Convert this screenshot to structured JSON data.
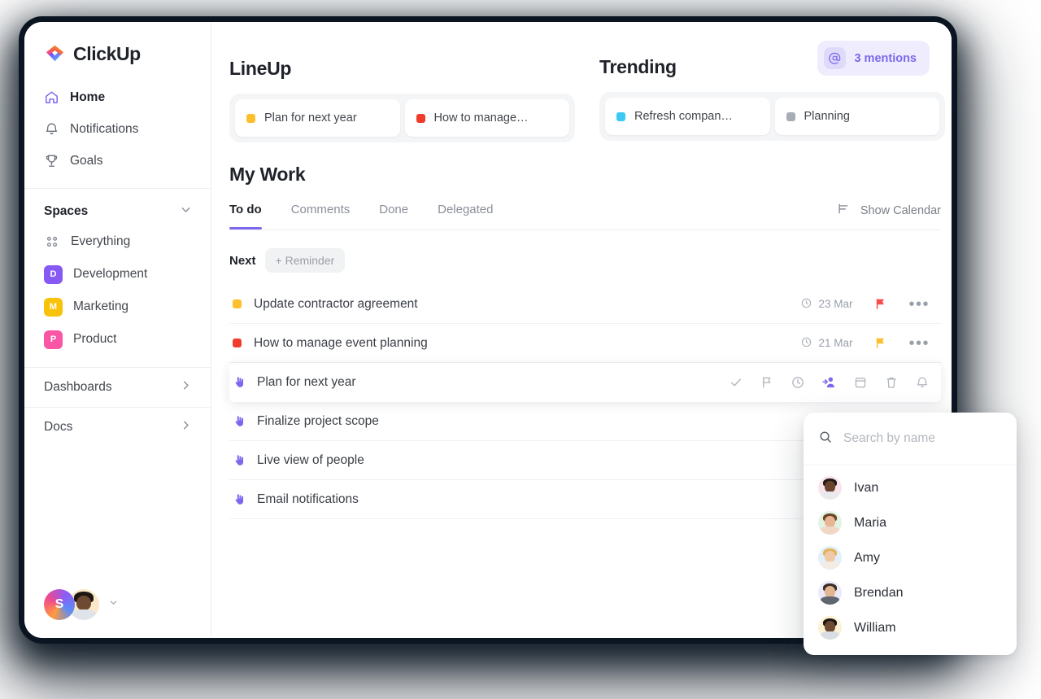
{
  "brand": {
    "name": "ClickUp",
    "logo_icon": "clickup-logo-icon",
    "accent": "#7b68ee"
  },
  "sidebar": {
    "nav": [
      {
        "label": "Home",
        "icon": "home-icon",
        "active": true
      },
      {
        "label": "Notifications",
        "icon": "bell-icon",
        "active": false
      },
      {
        "label": "Goals",
        "icon": "trophy-icon",
        "active": false
      }
    ],
    "spaces": {
      "title": "Spaces",
      "chevron_icon": "chevron-down-icon",
      "items": [
        {
          "label": "Everything",
          "badge": "",
          "icon": "grid-icon",
          "color": ""
        },
        {
          "label": "Development",
          "badge": "D",
          "color": "#8659f2"
        },
        {
          "label": "Marketing",
          "badge": "M",
          "color": "#f9c20a"
        },
        {
          "label": "Product",
          "badge": "P",
          "color": "#f956a5"
        }
      ]
    },
    "rows": [
      {
        "label": "Dashboards",
        "icon": "chevron-right-icon"
      },
      {
        "label": "Docs",
        "icon": "chevron-right-icon"
      }
    ],
    "footer": {
      "workspace_initial": "S",
      "user_avatar": "user-avatar",
      "caret_icon": "caret-down-icon"
    }
  },
  "header": {
    "mentions": {
      "label": "3 mentions",
      "icon": "at-icon"
    }
  },
  "lineup": {
    "title": "LineUp",
    "chips": [
      {
        "label": "Plan for next year",
        "color": "#fcbf2d"
      },
      {
        "label": "How to manage…",
        "color": "#ef3c2d"
      }
    ]
  },
  "trending": {
    "title": "Trending",
    "chips": [
      {
        "label": "Refresh compan…",
        "color": "#3ccaf5"
      },
      {
        "label": "Planning",
        "color": "#a8adb5"
      }
    ]
  },
  "my_work": {
    "title": "My Work",
    "tabs": [
      {
        "label": "To do",
        "active": true
      },
      {
        "label": "Comments",
        "active": false
      },
      {
        "label": "Done",
        "active": false
      },
      {
        "label": "Delegated",
        "active": false
      }
    ],
    "show_calendar": {
      "label": "Show Calendar",
      "icon": "calendar-toggle-icon"
    },
    "group": {
      "label": "Next",
      "add_reminder_label": "+ Reminder"
    },
    "tasks": [
      {
        "name": "Update contractor agreement",
        "marker": "dot",
        "dot_color": "#fcbf2d",
        "due": "23 Mar",
        "due_icon": "clock-icon",
        "flag_color": "#fb4b4b",
        "more_icon": "ellipsis-icon",
        "hovered": false
      },
      {
        "name": "How to manage event planning",
        "marker": "dot",
        "dot_color": "#ef3c2d",
        "due": "21 Mar",
        "due_icon": "clock-icon",
        "flag_color": "#fcbf2d",
        "more_icon": "ellipsis-icon",
        "hovered": false
      },
      {
        "name": "Plan for next year",
        "marker": "hand",
        "hovered": true,
        "actions": [
          {
            "icon": "check-icon",
            "active": false
          },
          {
            "icon": "flag-icon",
            "active": false
          },
          {
            "icon": "clock-icon",
            "active": false
          },
          {
            "icon": "assign-user-icon",
            "active": true
          },
          {
            "icon": "calendar-icon",
            "active": false
          },
          {
            "icon": "trash-icon",
            "active": false
          },
          {
            "icon": "bell-icon",
            "active": false
          }
        ]
      },
      {
        "name": "Finalize project scope",
        "marker": "hand",
        "hovered": false
      },
      {
        "name": "Live view of people",
        "marker": "hand",
        "hovered": false
      },
      {
        "name": "Email notifications",
        "marker": "hand",
        "hovered": false
      }
    ]
  },
  "assignee_popover": {
    "search": {
      "placeholder": "Search by name",
      "value": "",
      "icon": "search-icon"
    },
    "people": [
      {
        "name": "Ivan",
        "bg": "#fae4ec",
        "skin": "#6b4430",
        "hair": "#241a15",
        "shirt": "#e8eaee"
      },
      {
        "name": "Maria",
        "bg": "#e2f3e2",
        "skin": "#e8b694",
        "hair": "#6d4626",
        "shirt": "#f0d7c6"
      },
      {
        "name": "Amy",
        "bg": "#e3f0fb",
        "skin": "#f0c9a8",
        "hair": "#e2b45c",
        "shirt": "#f3ece4"
      },
      {
        "name": "Brendan",
        "bg": "#ece9f8",
        "skin": "#e3b692",
        "hair": "#3c2e25",
        "shirt": "#5f6670"
      },
      {
        "name": "William",
        "bg": "#fcf1d4",
        "skin": "#6f4a33",
        "hair": "#1d1713",
        "shirt": "#d9dee4"
      }
    ]
  }
}
